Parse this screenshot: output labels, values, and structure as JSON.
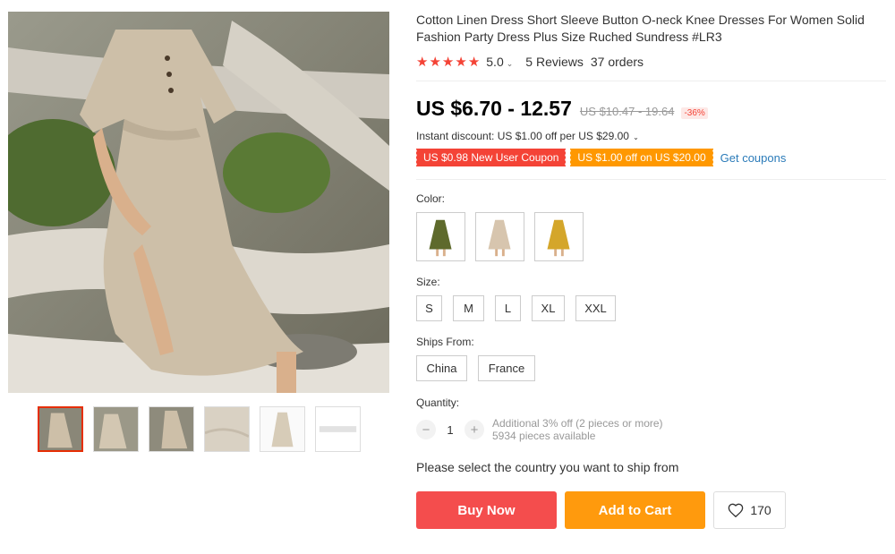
{
  "product": {
    "title": "Cotton Linen Dress Short Sleeve Button O-neck Knee Dresses For Women Solid Fashion Party Dress Plus Size Ruched Sundress #LR3",
    "rating_value": "5.0",
    "rating_stars": 5,
    "reviews": "5 Reviews",
    "orders": "37 orders"
  },
  "pricing": {
    "price": "US $6.70 - 12.57",
    "original_price": "US $10.47 - 19.64",
    "discount": "-36%",
    "instant_discount": "Instant discount: US $1.00 off per US $29.00"
  },
  "coupons": {
    "new_user": "US $0.98 New User Coupon",
    "store": "US $1.00 off on US $20.00",
    "get_coupons": "Get coupons"
  },
  "options": {
    "color_label": "Color:",
    "colors": [
      "olive-green dress",
      "beige dress",
      "mustard-yellow dress"
    ],
    "size_label": "Size:",
    "sizes": [
      "S",
      "M",
      "L",
      "XL",
      "XXL"
    ],
    "ships_from_label": "Ships From:",
    "ships_from": [
      "China",
      "France"
    ]
  },
  "quantity": {
    "label": "Quantity:",
    "value": "1",
    "minus": "−",
    "plus": "+",
    "additional": "Additional 3% off (2 pieces or more)",
    "available": "5934 pieces available"
  },
  "shipping_note": "Please select the country you want to ship from",
  "actions": {
    "buy_now": "Buy Now",
    "add_to_cart": "Add to Cart",
    "wishlist_count": "170"
  },
  "colors": {
    "price_red": "#f44336",
    "buy_button": "#f44d4d",
    "cart_button": "#ff9a0d",
    "link_blue": "#2b7bb9"
  },
  "icons": {
    "star": "star-icon",
    "chevron": "chevron-down-icon",
    "wishlist": "heart-icon"
  }
}
